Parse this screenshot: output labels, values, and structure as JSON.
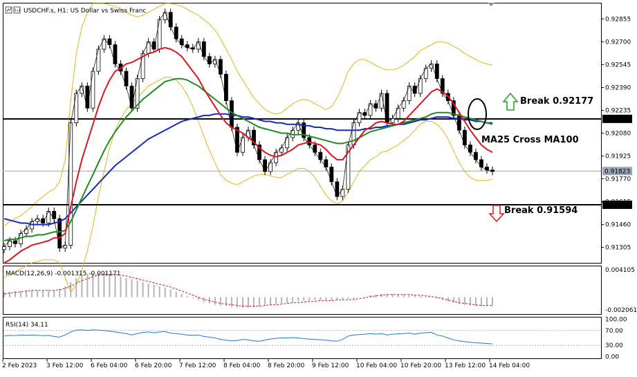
{
  "header": {
    "symbol_title": "USDCHF.s, H1:  US Dollar vs Swiss Franc"
  },
  "colors": {
    "candle": "#000000",
    "ma_fast": "#e0141e",
    "ma_mid": "#1e8c1e",
    "ma_slow": "#1428c8",
    "bollinger": "#e6b41e",
    "macd_signal": "#e0141e",
    "macd_hist": "#b4b4b4",
    "rsi_line": "#1e78d2",
    "up_arrow": "#1ea01e",
    "down_arrow": "#e0141e"
  },
  "annotations": {
    "break_up": "Break 0.92177",
    "break_down": "Break 0.91594",
    "ma_cross": "MA25 Cross MA100"
  },
  "chart_data": [
    {
      "type": "line",
      "name": "price",
      "price_axis_labels": [
        "0.92855",
        "0.92700",
        "0.92545",
        "0.92390",
        "0.92235",
        "0.92080",
        "0.91925",
        "0.91770",
        "0.91615",
        "0.91460",
        "0.91305"
      ],
      "current_price_label": "0.91823",
      "level_labels": [
        "0.92177",
        "0.91594"
      ],
      "levels": [
        0.92177,
        0.91594
      ],
      "ylim": [
        0.912,
        0.9296
      ],
      "time_labels": [
        "2 Feb 2023",
        "3 Feb 12:00",
        "6 Feb 04:00",
        "6 Feb 20:00",
        "7 Feb 12:00",
        "8 Feb 04:00",
        "8 Feb 20:00",
        "9 Feb 12:00",
        "10 Feb 04:00",
        "10 Feb 20:00",
        "13 Feb 12:00",
        "14 Feb 04:00"
      ],
      "close": [
        0.9131,
        0.9135,
        0.9133,
        0.914,
        0.9143,
        0.9148,
        0.915,
        0.9147,
        0.9155,
        0.915,
        0.913,
        0.9132,
        0.9215,
        0.9235,
        0.924,
        0.9225,
        0.925,
        0.9265,
        0.9272,
        0.9268,
        0.9255,
        0.925,
        0.924,
        0.9225,
        0.9245,
        0.9262,
        0.927,
        0.9265,
        0.9285,
        0.929,
        0.928,
        0.9272,
        0.9268,
        0.9266,
        0.9265,
        0.927,
        0.926,
        0.9255,
        0.9258,
        0.9248,
        0.923,
        0.9212,
        0.9195,
        0.9205,
        0.921,
        0.92,
        0.919,
        0.9182,
        0.9188,
        0.9195,
        0.9198,
        0.9205,
        0.921,
        0.9215,
        0.9205,
        0.92,
        0.9195,
        0.919,
        0.9185,
        0.9175,
        0.9165,
        0.917,
        0.92,
        0.9215,
        0.9222,
        0.922,
        0.9228,
        0.9225,
        0.9235,
        0.9215,
        0.9218,
        0.9225,
        0.923,
        0.924,
        0.9235,
        0.9245,
        0.9252,
        0.9255,
        0.9245,
        0.9235,
        0.923,
        0.922,
        0.921,
        0.92,
        0.9195,
        0.919,
        0.9185,
        0.9183,
        0.9182
      ],
      "ma25": [
        0.912,
        0.9122,
        0.9125,
        0.9128,
        0.913,
        0.9132,
        0.9133,
        0.9134,
        0.9135,
        0.9137,
        0.9137,
        0.914,
        0.9158,
        0.9175,
        0.919,
        0.9202,
        0.9214,
        0.9226,
        0.9236,
        0.9244,
        0.925,
        0.9252,
        0.9255,
        0.9256,
        0.9258,
        0.926,
        0.9262,
        0.9263,
        0.9265,
        0.9266,
        0.9265,
        0.9263,
        0.926,
        0.9255,
        0.925,
        0.9245,
        0.9238,
        0.9232,
        0.9226,
        0.922,
        0.9215,
        0.9212,
        0.921,
        0.9208,
        0.9205,
        0.9202,
        0.9198,
        0.9195,
        0.9193,
        0.9192,
        0.9193,
        0.9195,
        0.9197,
        0.92,
        0.9201,
        0.9202,
        0.9201,
        0.92,
        0.9197,
        0.9193,
        0.919,
        0.919,
        0.9195,
        0.92,
        0.9205,
        0.921,
        0.9212,
        0.9215,
        0.9216,
        0.9215,
        0.9214,
        0.9214,
        0.9216,
        0.922,
        0.9224,
        0.9228,
        0.9232,
        0.9236,
        0.9238,
        0.9236,
        0.9233,
        0.9228,
        0.9222,
        0.9216,
        0.921,
        0.9205,
        0.92,
        0.9197,
        0.9195
      ],
      "ma50": [
        0.9135,
        0.9136,
        0.9136,
        0.9137,
        0.9138,
        0.9138,
        0.9139,
        0.9139,
        0.914,
        0.9141,
        0.9141,
        0.9142,
        0.9148,
        0.9156,
        0.9164,
        0.9172,
        0.918,
        0.9188,
        0.9196,
        0.9203,
        0.9209,
        0.9214,
        0.9219,
        0.9223,
        0.9227,
        0.9231,
        0.9234,
        0.9237,
        0.924,
        0.9243,
        0.9244,
        0.9245,
        0.9245,
        0.9244,
        0.9242,
        0.924,
        0.9237,
        0.9234,
        0.9231,
        0.9228,
        0.9225,
        0.9222,
        0.922,
        0.9218,
        0.9216,
        0.9214,
        0.9212,
        0.9211,
        0.921,
        0.9209,
        0.9208,
        0.9208,
        0.9207,
        0.9207,
        0.9207,
        0.9206,
        0.9205,
        0.9204,
        0.9203,
        0.9202,
        0.9201,
        0.9201,
        0.9202,
        0.9203,
        0.9205,
        0.9207,
        0.9209,
        0.921,
        0.9211,
        0.9212,
        0.9213,
        0.9214,
        0.9215,
        0.9216,
        0.9217,
        0.9218,
        0.9219,
        0.9221,
        0.9222,
        0.9222,
        0.9222,
        0.9221,
        0.922,
        0.9219,
        0.9218,
        0.9217,
        0.9216,
        0.9215,
        0.9214
      ],
      "ma100": [
        0.915,
        0.9149,
        0.9148,
        0.9147,
        0.9147,
        0.9146,
        0.9146,
        0.9146,
        0.9146,
        0.9147,
        0.9148,
        0.915,
        0.9154,
        0.9158,
        0.9162,
        0.9166,
        0.917,
        0.9174,
        0.9178,
        0.9182,
        0.9186,
        0.9189,
        0.9192,
        0.9195,
        0.9198,
        0.9201,
        0.9204,
        0.9206,
        0.9208,
        0.921,
        0.9212,
        0.9214,
        0.9216,
        0.9217,
        0.9218,
        0.9219,
        0.922,
        0.922,
        0.9221,
        0.9221,
        0.9221,
        0.922,
        0.922,
        0.9219,
        0.9219,
        0.9218,
        0.9217,
        0.9216,
        0.9216,
        0.9215,
        0.9215,
        0.9214,
        0.9214,
        0.9214,
        0.9213,
        0.9213,
        0.9212,
        0.9212,
        0.9211,
        0.9211,
        0.921,
        0.921,
        0.921,
        0.921,
        0.921,
        0.9211,
        0.9211,
        0.9212,
        0.9212,
        0.9213,
        0.9213,
        0.9214,
        0.9214,
        0.9215,
        0.9216,
        0.9217,
        0.9217,
        0.9218,
        0.9219,
        0.9219,
        0.9219,
        0.9218,
        0.9218,
        0.9217,
        0.9217,
        0.9216,
        0.9216,
        0.9215,
        0.9215
      ],
      "bb_upper": [
        0.9145,
        0.9148,
        0.915,
        0.9152,
        0.9155,
        0.9158,
        0.9162,
        0.9165,
        0.9168,
        0.917,
        0.9175,
        0.919,
        0.923,
        0.9262,
        0.928,
        0.929,
        0.9296,
        0.9296,
        0.9296,
        0.9295,
        0.9294,
        0.9292,
        0.929,
        0.9288,
        0.9287,
        0.9288,
        0.929,
        0.9292,
        0.9294,
        0.9296,
        0.9296,
        0.9295,
        0.9294,
        0.9292,
        0.929,
        0.9288,
        0.9285,
        0.9282,
        0.9278,
        0.9272,
        0.9265,
        0.9258,
        0.925,
        0.9244,
        0.9238,
        0.9232,
        0.9228,
        0.9224,
        0.9222,
        0.9221,
        0.9222,
        0.9225,
        0.9228,
        0.923,
        0.9231,
        0.923,
        0.9228,
        0.9226,
        0.9224,
        0.9226,
        0.9232,
        0.924,
        0.925,
        0.9255,
        0.9258,
        0.9258,
        0.9256,
        0.9254,
        0.9252,
        0.9251,
        0.9251,
        0.9252,
        0.9254,
        0.9257,
        0.926,
        0.9264,
        0.9266,
        0.9268,
        0.927,
        0.927,
        0.9269,
        0.9267,
        0.9265,
        0.9262,
        0.926,
        0.9258,
        0.9256,
        0.9255,
        0.9254
      ],
      "bb_lower": [
        0.911,
        0.9112,
        0.9114,
        0.9116,
        0.9118,
        0.912,
        0.9121,
        0.9122,
        0.9122,
        0.9122,
        0.912,
        0.911,
        0.91,
        0.9105,
        0.9115,
        0.9128,
        0.9145,
        0.9165,
        0.9182,
        0.9198,
        0.921,
        0.9218,
        0.9224,
        0.9228,
        0.9232,
        0.9236,
        0.924,
        0.9242,
        0.9244,
        0.9246,
        0.9246,
        0.9244,
        0.924,
        0.9234,
        0.9226,
        0.9216,
        0.9206,
        0.9196,
        0.9188,
        0.918,
        0.9176,
        0.9174,
        0.9173,
        0.9175,
        0.9177,
        0.9179,
        0.918,
        0.918,
        0.9179,
        0.9178,
        0.9178,
        0.918,
        0.9182,
        0.9184,
        0.9184,
        0.9182,
        0.9178,
        0.9172,
        0.9166,
        0.9162,
        0.916,
        0.9162,
        0.9168,
        0.9175,
        0.9182,
        0.9186,
        0.919,
        0.9192,
        0.9195,
        0.9196,
        0.9198,
        0.92,
        0.9203,
        0.9206,
        0.921,
        0.9214,
        0.9216,
        0.9216,
        0.9214,
        0.921,
        0.9204,
        0.9196,
        0.9188,
        0.9182,
        0.9178,
        0.9176,
        0.9176,
        0.9176,
        0.9177
      ]
    },
    {
      "type": "bar",
      "name": "macd",
      "header": "MACD(12,26,9) -0.001315 -0.001171",
      "axis_labels": [
        "0.004105",
        "-0.002061"
      ],
      "ylim": [
        -0.00245,
        0.0045
      ],
      "histogram": [
        0.0008,
        0.0008,
        0.0009,
        0.0009,
        0.001,
        0.001,
        0.001,
        0.001,
        0.001,
        0.001,
        0.0012,
        0.0016,
        0.0022,
        0.0028,
        0.0032,
        0.0034,
        0.0035,
        0.0035,
        0.0034,
        0.0033,
        0.0032,
        0.003,
        0.0028,
        0.0026,
        0.0024,
        0.0022,
        0.002,
        0.0018,
        0.0016,
        0.0014,
        0.0011,
        0.0008,
        0.0005,
        0.0002,
        -0.0001,
        -0.0004,
        -0.0007,
        -0.0009,
        -0.0011,
        -0.0012,
        -0.0013,
        -0.0014,
        -0.0015,
        -0.0015,
        -0.0015,
        -0.0014,
        -0.0013,
        -0.0012,
        -0.0011,
        -0.001,
        -0.0009,
        -0.0008,
        -0.0007,
        -0.0006,
        -0.0005,
        -0.0005,
        -0.0004,
        -0.0004,
        -0.0004,
        -0.0004,
        -0.0004,
        -0.0004,
        -0.0003,
        -0.0002,
        0.0,
        0.0001,
        0.0003,
        0.0004,
        0.0005,
        0.0005,
        0.0005,
        0.0004,
        0.0004,
        0.0003,
        0.0003,
        0.0002,
        0.0001,
        0.0,
        -0.0002,
        -0.0004,
        -0.0006,
        -0.0008,
        -0.001,
        -0.0011,
        -0.0012,
        -0.0013,
        -0.0013,
        -0.0013,
        -0.0013
      ],
      "signal": [
        0.0005,
        0.0006,
        0.0007,
        0.0008,
        0.0009,
        0.001,
        0.001,
        0.001,
        0.001,
        0.001,
        0.0011,
        0.0013,
        0.0016,
        0.002,
        0.0024,
        0.0027,
        0.003,
        0.0032,
        0.0033,
        0.0033,
        0.0033,
        0.0032,
        0.0031,
        0.0029,
        0.0027,
        0.0025,
        0.0023,
        0.0021,
        0.0019,
        0.0017,
        0.0015,
        0.0012,
        0.0009,
        0.0006,
        0.0003,
        0.0,
        -0.0003,
        -0.0005,
        -0.0007,
        -0.0009,
        -0.001,
        -0.0011,
        -0.0012,
        -0.0013,
        -0.0013,
        -0.0013,
        -0.0013,
        -0.0012,
        -0.0011,
        -0.0011,
        -0.001,
        -0.0009,
        -0.0008,
        -0.0008,
        -0.0007,
        -0.0006,
        -0.0006,
        -0.0005,
        -0.0005,
        -0.0005,
        -0.0004,
        -0.0004,
        -0.0004,
        -0.0003,
        -0.0002,
        -0.0001,
        0.0001,
        0.0002,
        0.0003,
        0.0004,
        0.0004,
        0.0004,
        0.0004,
        0.0004,
        0.0003,
        0.0003,
        0.0002,
        0.0001,
        0.0,
        -0.0002,
        -0.0004,
        -0.0006,
        -0.0008,
        -0.0009,
        -0.001,
        -0.0011,
        -0.0012,
        -0.0012,
        -0.0012
      ]
    },
    {
      "type": "line",
      "name": "rsi",
      "header": "RSI(14) 34.11",
      "axis_labels": [
        "100.00",
        "70.00",
        "30.00",
        "0.00"
      ],
      "levels": [
        70,
        30
      ],
      "ylim": [
        -5,
        105
      ],
      "values": [
        55,
        57,
        56,
        58,
        57,
        58,
        57,
        56,
        57,
        54,
        52,
        58,
        66,
        71,
        72,
        70,
        72,
        71,
        70,
        68,
        66,
        64,
        62,
        58,
        62,
        65,
        66,
        64,
        66,
        67,
        63,
        62,
        60,
        58,
        57,
        58,
        54,
        52,
        50,
        46,
        44,
        42,
        43,
        46,
        45,
        42,
        41,
        44,
        47,
        49,
        50,
        50,
        51,
        50,
        48,
        47,
        46,
        45,
        44,
        42,
        41,
        46,
        55,
        58,
        59,
        60,
        62,
        60,
        62,
        58,
        60,
        61,
        62,
        63,
        60,
        63,
        64,
        65,
        58,
        55,
        50,
        45,
        42,
        40,
        38,
        37,
        36,
        35,
        34
      ]
    }
  ]
}
